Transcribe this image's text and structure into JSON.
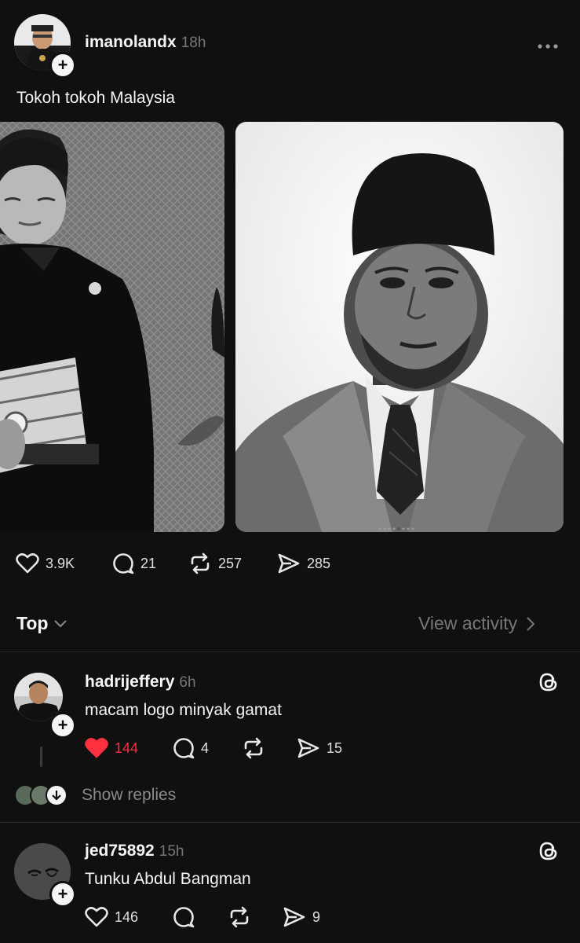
{
  "post": {
    "username": "imanolandx",
    "time": "18h",
    "text": "Tokoh tokoh Malaysia",
    "likes": "3.9K",
    "comments": "21",
    "reposts": "257",
    "shares": "285"
  },
  "sort": {
    "label": "Top",
    "view_activity": "View activity"
  },
  "replies": [
    {
      "username": "hadrijeffery",
      "time": "6h",
      "text": "macam logo minyak gamat",
      "likes": "144",
      "comments": "4",
      "shares": "15",
      "liked": true
    },
    {
      "username": "jed75892",
      "time": "15h",
      "text": "Tunku Abdul Bangman",
      "likes": "146",
      "shares": "9",
      "liked": false
    }
  ],
  "show_replies_label": "Show replies",
  "colors": {
    "background": "#101010",
    "like_red": "#ff3040",
    "muted": "#777777"
  }
}
